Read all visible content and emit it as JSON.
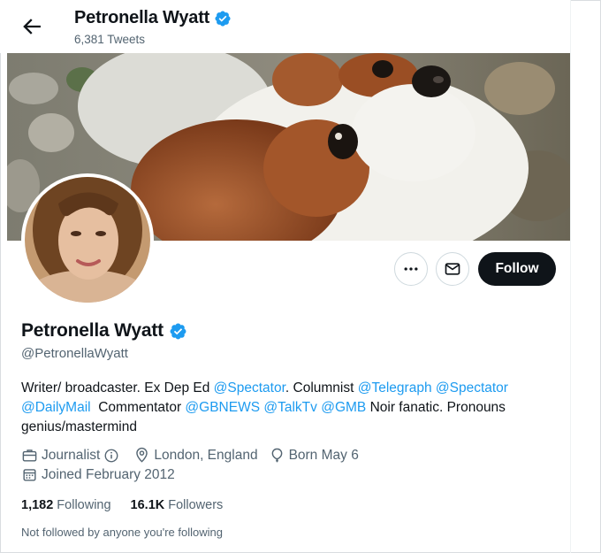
{
  "header": {
    "name": "Petronella Wyatt",
    "tweet_count": "6,381 Tweets"
  },
  "profile": {
    "name": "Petronella Wyatt",
    "handle": "@PetronellaWyatt",
    "bio": {
      "t1": "Writer/ broadcaster. Ex Dep Ed ",
      "l1": "@Spectator",
      "t2": ". Columnist ",
      "l2": "@Telegraph",
      "t3": " ",
      "l3": "@Spectator",
      "t4": " ",
      "l4": "@DailyMail",
      "t5": "  Commentator ",
      "l5": "@GBNEWS",
      "t6": " ",
      "l6": "@TalkTv",
      "t7": " ",
      "l7": "@GMB",
      "t8": " Noir fanatic. Pronouns genius/mastermind"
    },
    "category": "Journalist",
    "location": "London, England",
    "born": "Born May 6",
    "joined": "Joined February 2012",
    "following_count": "1,182",
    "following_label": "Following",
    "followers_count": "16.1K",
    "followers_label": "Followers",
    "not_followed": "Not followed by anyone you're following"
  },
  "actions": {
    "follow_label": "Follow"
  },
  "colors": {
    "accent": "#1d9bf0",
    "follow_bg": "#0f1419",
    "secondary_text": "#536471"
  },
  "icons": [
    "back-arrow-icon",
    "verified-badge-icon",
    "more-icon",
    "message-icon",
    "briefcase-icon",
    "info-icon",
    "location-icon",
    "balloon-icon",
    "calendar-icon"
  ]
}
